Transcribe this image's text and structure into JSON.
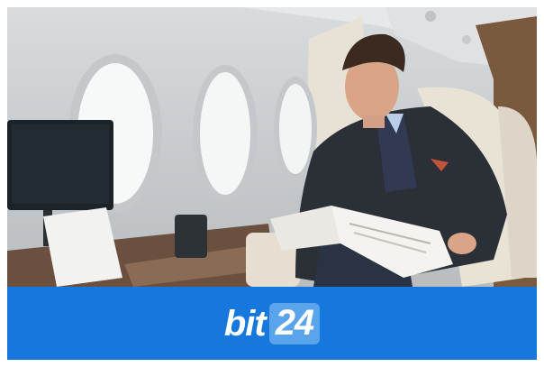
{
  "photo": {
    "subject": "man-in-business-jet-cabin",
    "icons": [
      "airplane-window-icon",
      "monitor-icon",
      "newspaper-icon",
      "seat-icon"
    ]
  },
  "brand": {
    "word": "bit",
    "number": "24",
    "bar_color": "#1678dc",
    "box_color": "#5aa4ec"
  }
}
